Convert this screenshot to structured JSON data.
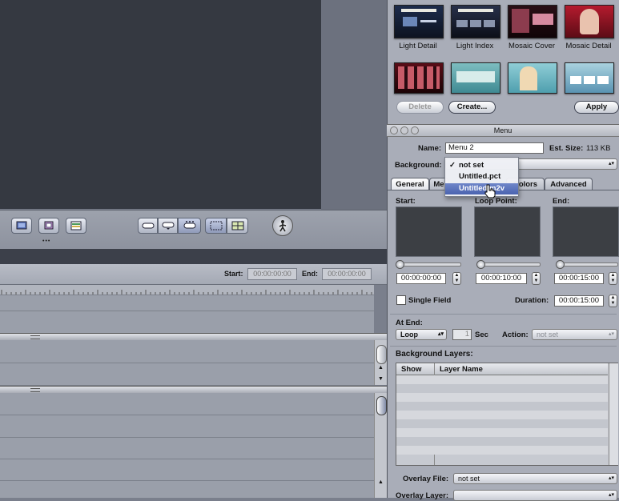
{
  "toolbar": {
    "start_label": "Start:",
    "start_value": "00:00:00:00",
    "end_label": "End:",
    "end_value": "00:00:00:00",
    "dots": "•••"
  },
  "templates": {
    "items": [
      {
        "label": "Light Detail"
      },
      {
        "label": "Light Index"
      },
      {
        "label": "Mosaic Cover"
      },
      {
        "label": "Mosaic Detail"
      }
    ],
    "delete_label": "Delete",
    "create_label": "Create...",
    "apply_label": "Apply"
  },
  "menu_window": {
    "title": "Menu",
    "name_label": "Name:",
    "name_value": "Menu 2",
    "est_size_label": "Est. Size:",
    "est_size_value": "113 KB",
    "background_label": "Background:",
    "dropdown": {
      "items": [
        {
          "label": "not set",
          "checked": true
        },
        {
          "label": "Untitled.pct"
        },
        {
          "label": "Untitled.m2v"
        }
      ]
    },
    "tabs": [
      {
        "label": "General",
        "active": true
      },
      {
        "label": "Me"
      },
      {
        "label": "Colors"
      },
      {
        "label": "Advanced"
      }
    ],
    "start_label": "Start:",
    "loop_point_label": "Loop Point:",
    "end_label": "End:",
    "start_tc": "00:00:00:00",
    "loop_tc": "00:00:10:00",
    "end_tc": "00:00:15:00",
    "single_field_label": "Single Field",
    "duration_label": "Duration:",
    "duration_value": "00:00:15:00",
    "at_end_label": "At End:",
    "at_end_value": "Loop",
    "sec_value": "1",
    "sec_label": "Sec",
    "action_label": "Action:",
    "action_value": "not set",
    "bg_layers_title": "Background Layers:",
    "col_show": "Show",
    "col_layer_name": "Layer Name",
    "overlay_file_label": "Overlay File:",
    "overlay_file_value": "not set",
    "overlay_layer_label": "Overlay Layer:"
  },
  "colors": {
    "viewer_bg": "#353941",
    "panel_bg": "#a9adb8",
    "selection": "#4a63b0"
  }
}
